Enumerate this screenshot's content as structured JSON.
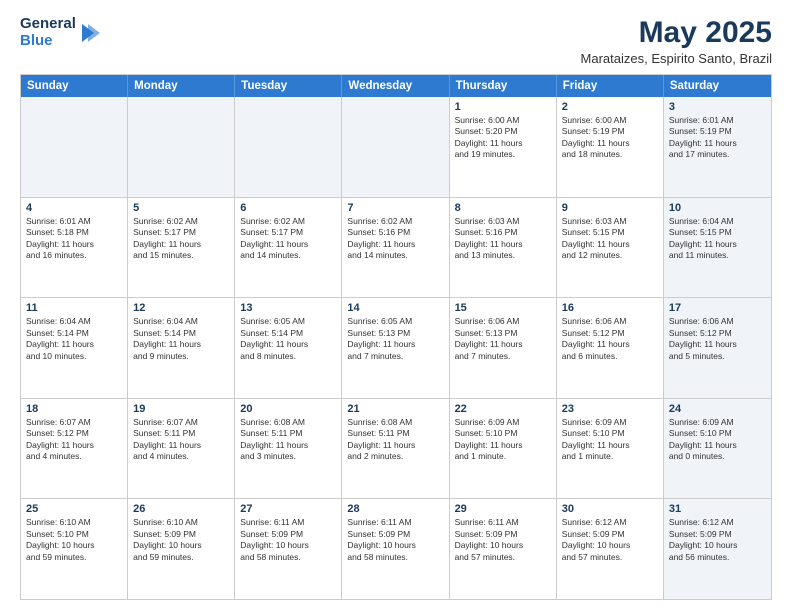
{
  "logo": {
    "general": "General",
    "blue": "Blue",
    "tagline": ""
  },
  "header": {
    "title": "May 2025",
    "location": "Marataizes, Espirito Santo, Brazil"
  },
  "weekdays": [
    "Sunday",
    "Monday",
    "Tuesday",
    "Wednesday",
    "Thursday",
    "Friday",
    "Saturday"
  ],
  "weeks": [
    [
      {
        "day": "",
        "text": "",
        "shaded": true
      },
      {
        "day": "",
        "text": "",
        "shaded": true
      },
      {
        "day": "",
        "text": "",
        "shaded": true
      },
      {
        "day": "",
        "text": "",
        "shaded": true
      },
      {
        "day": "1",
        "text": "Sunrise: 6:00 AM\nSunset: 5:20 PM\nDaylight: 11 hours\nand 19 minutes."
      },
      {
        "day": "2",
        "text": "Sunrise: 6:00 AM\nSunset: 5:19 PM\nDaylight: 11 hours\nand 18 minutes."
      },
      {
        "day": "3",
        "text": "Sunrise: 6:01 AM\nSunset: 5:19 PM\nDaylight: 11 hours\nand 17 minutes.",
        "shaded": true
      }
    ],
    [
      {
        "day": "4",
        "text": "Sunrise: 6:01 AM\nSunset: 5:18 PM\nDaylight: 11 hours\nand 16 minutes."
      },
      {
        "day": "5",
        "text": "Sunrise: 6:02 AM\nSunset: 5:17 PM\nDaylight: 11 hours\nand 15 minutes."
      },
      {
        "day": "6",
        "text": "Sunrise: 6:02 AM\nSunset: 5:17 PM\nDaylight: 11 hours\nand 14 minutes."
      },
      {
        "day": "7",
        "text": "Sunrise: 6:02 AM\nSunset: 5:16 PM\nDaylight: 11 hours\nand 14 minutes."
      },
      {
        "day": "8",
        "text": "Sunrise: 6:03 AM\nSunset: 5:16 PM\nDaylight: 11 hours\nand 13 minutes."
      },
      {
        "day": "9",
        "text": "Sunrise: 6:03 AM\nSunset: 5:15 PM\nDaylight: 11 hours\nand 12 minutes."
      },
      {
        "day": "10",
        "text": "Sunrise: 6:04 AM\nSunset: 5:15 PM\nDaylight: 11 hours\nand 11 minutes.",
        "shaded": true
      }
    ],
    [
      {
        "day": "11",
        "text": "Sunrise: 6:04 AM\nSunset: 5:14 PM\nDaylight: 11 hours\nand 10 minutes."
      },
      {
        "day": "12",
        "text": "Sunrise: 6:04 AM\nSunset: 5:14 PM\nDaylight: 11 hours\nand 9 minutes."
      },
      {
        "day": "13",
        "text": "Sunrise: 6:05 AM\nSunset: 5:14 PM\nDaylight: 11 hours\nand 8 minutes."
      },
      {
        "day": "14",
        "text": "Sunrise: 6:05 AM\nSunset: 5:13 PM\nDaylight: 11 hours\nand 7 minutes."
      },
      {
        "day": "15",
        "text": "Sunrise: 6:06 AM\nSunset: 5:13 PM\nDaylight: 11 hours\nand 7 minutes."
      },
      {
        "day": "16",
        "text": "Sunrise: 6:06 AM\nSunset: 5:12 PM\nDaylight: 11 hours\nand 6 minutes."
      },
      {
        "day": "17",
        "text": "Sunrise: 6:06 AM\nSunset: 5:12 PM\nDaylight: 11 hours\nand 5 minutes.",
        "shaded": true
      }
    ],
    [
      {
        "day": "18",
        "text": "Sunrise: 6:07 AM\nSunset: 5:12 PM\nDaylight: 11 hours\nand 4 minutes."
      },
      {
        "day": "19",
        "text": "Sunrise: 6:07 AM\nSunset: 5:11 PM\nDaylight: 11 hours\nand 4 minutes."
      },
      {
        "day": "20",
        "text": "Sunrise: 6:08 AM\nSunset: 5:11 PM\nDaylight: 11 hours\nand 3 minutes."
      },
      {
        "day": "21",
        "text": "Sunrise: 6:08 AM\nSunset: 5:11 PM\nDaylight: 11 hours\nand 2 minutes."
      },
      {
        "day": "22",
        "text": "Sunrise: 6:09 AM\nSunset: 5:10 PM\nDaylight: 11 hours\nand 1 minute."
      },
      {
        "day": "23",
        "text": "Sunrise: 6:09 AM\nSunset: 5:10 PM\nDaylight: 11 hours\nand 1 minute."
      },
      {
        "day": "24",
        "text": "Sunrise: 6:09 AM\nSunset: 5:10 PM\nDaylight: 11 hours\nand 0 minutes.",
        "shaded": true
      }
    ],
    [
      {
        "day": "25",
        "text": "Sunrise: 6:10 AM\nSunset: 5:10 PM\nDaylight: 10 hours\nand 59 minutes."
      },
      {
        "day": "26",
        "text": "Sunrise: 6:10 AM\nSunset: 5:09 PM\nDaylight: 10 hours\nand 59 minutes."
      },
      {
        "day": "27",
        "text": "Sunrise: 6:11 AM\nSunset: 5:09 PM\nDaylight: 10 hours\nand 58 minutes."
      },
      {
        "day": "28",
        "text": "Sunrise: 6:11 AM\nSunset: 5:09 PM\nDaylight: 10 hours\nand 58 minutes."
      },
      {
        "day": "29",
        "text": "Sunrise: 6:11 AM\nSunset: 5:09 PM\nDaylight: 10 hours\nand 57 minutes."
      },
      {
        "day": "30",
        "text": "Sunrise: 6:12 AM\nSunset: 5:09 PM\nDaylight: 10 hours\nand 57 minutes."
      },
      {
        "day": "31",
        "text": "Sunrise: 6:12 AM\nSunset: 5:09 PM\nDaylight: 10 hours\nand 56 minutes.",
        "shaded": true
      }
    ]
  ]
}
